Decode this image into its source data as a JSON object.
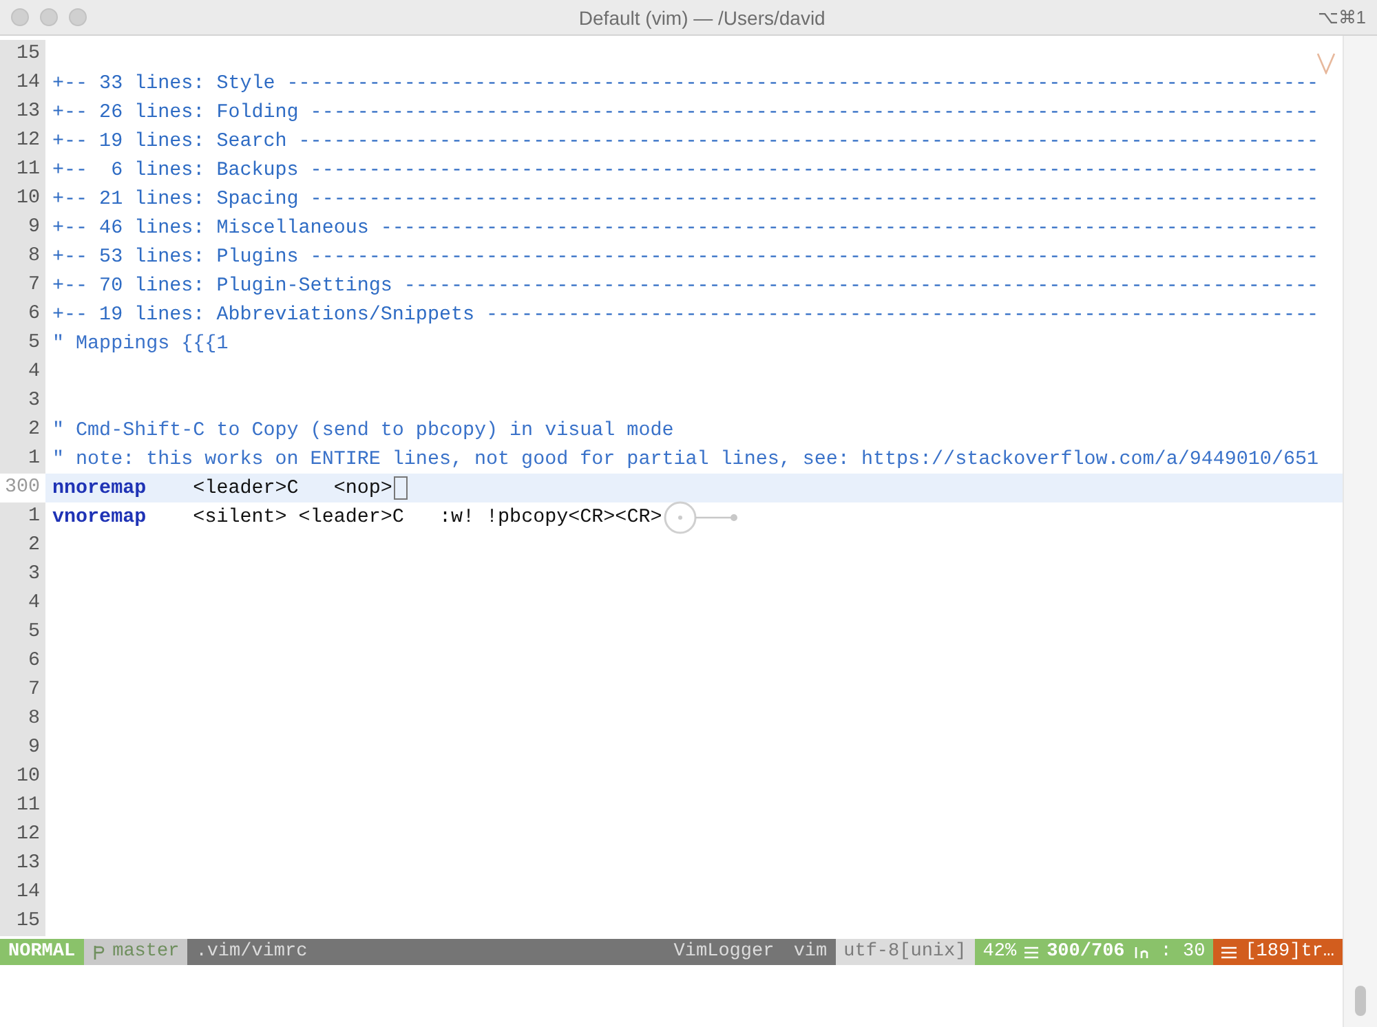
{
  "window": {
    "title": "Default (vim) — /Users/david",
    "shortcut": "⌥⌘1"
  },
  "lines": [
    {
      "number": "15",
      "kind": "blank",
      "current": false
    },
    {
      "number": "14",
      "kind": "fold",
      "text": "+-- 33 lines: Style ----------------------------------------------------------------------------------------",
      "current": false
    },
    {
      "number": "13",
      "kind": "fold",
      "text": "+-- 26 lines: Folding --------------------------------------------------------------------------------------",
      "current": false
    },
    {
      "number": "12",
      "kind": "fold",
      "text": "+-- 19 lines: Search ---------------------------------------------------------------------------------------",
      "current": false
    },
    {
      "number": "11",
      "kind": "fold",
      "text": "+--  6 lines: Backups --------------------------------------------------------------------------------------",
      "current": false
    },
    {
      "number": "10",
      "kind": "fold",
      "text": "+-- 21 lines: Spacing --------------------------------------------------------------------------------------",
      "current": false
    },
    {
      "number": "9",
      "kind": "fold",
      "text": "+-- 46 lines: Miscellaneous --------------------------------------------------------------------------------",
      "current": false
    },
    {
      "number": "8",
      "kind": "fold",
      "text": "+-- 53 lines: Plugins --------------------------------------------------------------------------------------",
      "current": false
    },
    {
      "number": "7",
      "kind": "fold",
      "text": "+-- 70 lines: Plugin-Settings ------------------------------------------------------------------------------",
      "current": false
    },
    {
      "number": "6",
      "kind": "fold",
      "text": "+-- 19 lines: Abbreviations/Snippets -----------------------------------------------------------------------",
      "current": false
    },
    {
      "number": "5",
      "kind": "comment",
      "text": "\" Mappings {{{1",
      "current": false
    },
    {
      "number": "4",
      "kind": "blank",
      "current": false
    },
    {
      "number": "3",
      "kind": "blank",
      "current": false
    },
    {
      "number": "2",
      "kind": "comment",
      "text": "\" Cmd-Shift-C to Copy (send to pbcopy) in visual mode",
      "current": false
    },
    {
      "number": "1",
      "kind": "comment",
      "text": "\" note: this works on ENTIRE lines, not good for partial lines, see: https://stackoverflow.com/a/9449010/651",
      "current": false
    },
    {
      "number": "300",
      "kind": "mapping",
      "keyword": "nnoremap",
      "text": "    <leader>C   <nop>",
      "current": true
    },
    {
      "number": "1",
      "kind": "mapping",
      "keyword": "vnoremap",
      "text": "    <silent> <leader>C   :w! !pbcopy<CR><CR>",
      "current": false
    },
    {
      "number": "2",
      "kind": "blank",
      "current": false
    },
    {
      "number": "3",
      "kind": "blank",
      "current": false
    },
    {
      "number": "4",
      "kind": "blank",
      "current": false
    },
    {
      "number": "5",
      "kind": "blank",
      "current": false
    },
    {
      "number": "6",
      "kind": "blank",
      "current": false
    },
    {
      "number": "7",
      "kind": "blank",
      "current": false
    },
    {
      "number": "8",
      "kind": "blank",
      "current": false
    },
    {
      "number": "9",
      "kind": "blank",
      "current": false
    },
    {
      "number": "10",
      "kind": "blank",
      "current": false
    },
    {
      "number": "11",
      "kind": "blank",
      "current": false
    },
    {
      "number": "12",
      "kind": "blank",
      "current": false
    },
    {
      "number": "13",
      "kind": "blank",
      "current": false
    },
    {
      "number": "14",
      "kind": "blank",
      "current": false
    },
    {
      "number": "15",
      "kind": "blank",
      "current": false
    }
  ],
  "status_bar": {
    "mode": "NORMAL",
    "branch": "master",
    "file": ".vim/vimrc",
    "plugin": "VimLogger",
    "filetype": "vim",
    "encoding": "utf-8[unix]",
    "percent": "42%",
    "position": "300/706",
    "column": ": 30",
    "warning": "[189]tr…"
  }
}
